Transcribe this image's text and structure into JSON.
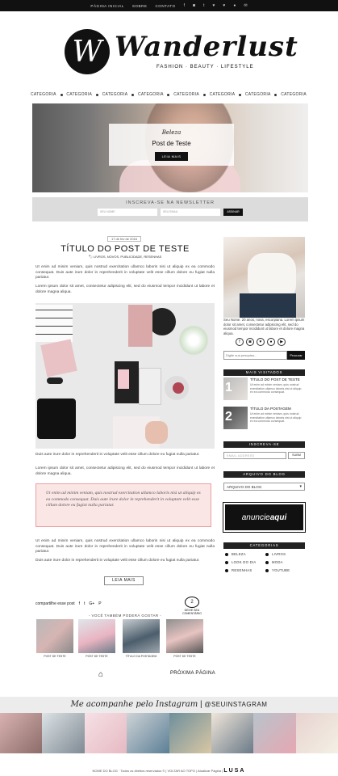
{
  "topbar": {
    "links": [
      "PÁGINA INICIAL",
      "SOBRE",
      "CONTATO"
    ],
    "icons": [
      "f",
      "◙",
      "t",
      "♥",
      "♥",
      "●",
      "✉"
    ]
  },
  "logo": {
    "monogram": "W",
    "title": "Wanderlust",
    "tagline": "FASHION · BEAUTY · LIFESTYLE"
  },
  "catnav": [
    "CATEGORIA",
    "CATEGORIA",
    "CATEGORIA",
    "CATEGORIA",
    "CATEGORIA",
    "CATEGORIA",
    "CATEGORIA",
    "CATEGORIA"
  ],
  "slider": {
    "category": "Beleza",
    "title": "Post de Teste",
    "button": "LEIA MAIS"
  },
  "newsletter": {
    "title": "INSCREVA-SE NA NEWSLETTER",
    "name_placeholder": "SEU NOME",
    "email_placeholder": "SEU EMAIL",
    "button": "ASSINAR"
  },
  "post": {
    "date": "17 de fev de 2016",
    "title": "TÍTULO DO POST DE TESTE",
    "meta": "LIVROS, NOVOS, PUBLICIDADE, RESENHAS",
    "p1": "Ut enim ad minim veniam, quis nostrud exercitation ullamco laboris nisi ut aliquip ex ea commodo consequat. Duis aute irure dolor in reprehenderit in voluptate velit esse cillum dolore eu fugiat nulla pariatur.",
    "p2": "Lorem ipsum dolor sit amet, consectetur adipiscing elit, sed do eiusmod tempor incididunt ut labore et dolore magna aliqua.",
    "p3": "Duis aute irure dolor in reprehenderit in voluptate velit esse cillum dolore eu fugiat nulla pariatur.",
    "p4": "Lorem ipsum dolor sit amet, consectetur adipiscing elit, sed do eiusmod tempor incididunt ut labore et dolore magna aliqua.",
    "quote": "Ut enim ad minim veniam, quis nostrud exercitation ullamco laboris nisi ut aliquip ex ea commodo consequat. Duis aute irure dolor in reprehenderit in voluptate velit esse cillum dolore eu fugiat nulla pariatur.",
    "p5": "Ut enim ad minim veniam, quis nostrud exercitation ullamco laboris nisi ut aliquip ex ea commodo consequat. Duis aute irure dolor in reprehenderit in voluptate velit esse cillum dolore eu fugiat nulla pariatur.",
    "p6": "Duis aute irure dolor in reprehenderit in voluptate velit esse cillum dolore eu fugiat nulla pariatur.",
    "read_more": "LEIA MAIS",
    "share_label": "compartilhe esse post",
    "share_icons": [
      "f",
      "t",
      "G+",
      "P"
    ],
    "comment_count": "2",
    "comment_label": "DEIXE SEU COMENTÁRIO",
    "related_title": "- VOCÊ TAMBÉM PODERÁ GOSTAR -",
    "related": [
      {
        "caption": "POST DE TESTE",
        "color": "#c9a7a4"
      },
      {
        "caption": "POST DE TESTE",
        "color": "#9aa7b3"
      },
      {
        "caption": "TÍTULO DA POSTAGEM",
        "color": "#6f7f8c"
      },
      {
        "caption": "POST DE TESTE",
        "color": "#d9b9b5"
      }
    ],
    "next_page": "PRÓXIMA PÁGINA"
  },
  "sidebar": {
    "about": "Seu Nome. 20 anos, nova, escorpiana. Lorem ipsum dolor sit amet, consectetur adipiscing elit, sed do eiusmod tempor incididunt ut labore et dolore magna aliqua.",
    "social": [
      "f",
      "◙",
      "♥",
      "●",
      "▶"
    ],
    "search_placeholder": "Digite sua pesquisa...",
    "search_button": "Procurar",
    "popular_head": "MAIS VISITADOS",
    "popular": [
      {
        "num": "1",
        "title": "TÍTULO DO POST DE TESTE",
        "text": "Ut enim ad minim veniam, quis nostrud exercitation ullamco laboris nisi ut aliquip ex ea commodo consequat."
      },
      {
        "num": "2",
        "title": "TÍTULO DA POSTAGEM",
        "text": "Ut enim ad minim veniam, quis nostrud exercitation ullamco laboris nisi ut aliquip ex ea commodo consequat."
      }
    ],
    "subscribe_head": "INSCREVA-SE",
    "subscribe_placeholder": "EMAIL ADDRESS",
    "subscribe_button": "SUBM",
    "archive_head": "ARQUIVO DO BLOG",
    "archive_select": "ARQUIVO DO BLOG",
    "ad_left": "anuncie",
    "ad_right": "aqui",
    "categories_head": "CATEGORIAS",
    "categories": [
      "BELEZA",
      "LIVROS",
      "LOOK DO DIA",
      "MODA",
      "RESENHAS",
      "YOUTUBE"
    ]
  },
  "instagram": {
    "label": "Me acompanhe pelo Instagram",
    "handle": "@SEUINSTAGRAM",
    "tiles": [
      "#d8b2b0",
      "#7f8a93",
      "#e6b9c2",
      "#cfd3d6",
      "#6e8f9c",
      "#f0e6da",
      "#b8c4cc",
      "#e8d2cf"
    ]
  },
  "footer": {
    "text": "NOME DO BLOG · Todos os direitos reservados © | VOLTAR AO TOPO | Atualizar Página |",
    "brand": "LUSA"
  }
}
